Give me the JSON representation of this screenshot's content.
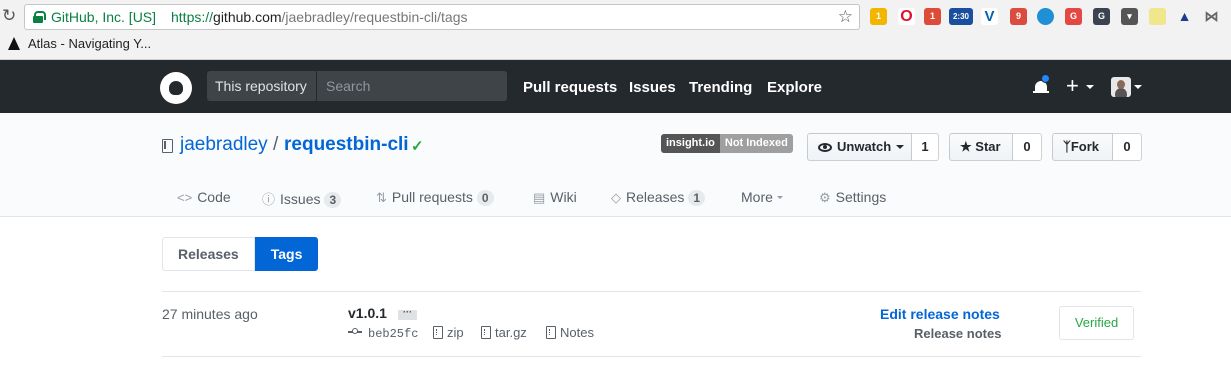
{
  "browser": {
    "secure_label": "GitHub, Inc. [US]",
    "url_scheme": "https://",
    "url_host": "github.com",
    "url_path": "/jaebradley/requestbin-cli/tags",
    "bookmark_label": "Atlas - Navigating Y...",
    "extension_badges": {
      "mail": "1",
      "time": "2:30",
      "todo": "9",
      "first": "1"
    }
  },
  "header": {
    "search_scope": "This repository",
    "search_placeholder": "Search",
    "nav": [
      "Pull requests",
      "Issues",
      "Trending",
      "Explore"
    ],
    "plus": "+"
  },
  "repo": {
    "owner": "jaebradley",
    "separator": "/",
    "name": "requestbin-cli",
    "verified_check": "✓",
    "insight_label": "insight.io",
    "insight_status": "Not Indexed",
    "unwatch_label": "Unwatch",
    "watch_count": "1",
    "star_label": "Star",
    "star_count": "0",
    "fork_label": "Fork",
    "fork_count": "0"
  },
  "tabs": {
    "code": "Code",
    "issues": "Issues",
    "issues_count": "3",
    "pulls": "Pull requests",
    "pulls_count": "0",
    "wiki": "Wiki",
    "releases": "Releases",
    "releases_count": "1",
    "more": "More",
    "settings": "Settings"
  },
  "subnav": {
    "releases": "Releases",
    "tags": "Tags"
  },
  "tag": {
    "time_ago": "27 minutes ago",
    "name": "v1.0.1",
    "ellipsis": "···",
    "commit": "beb25fc",
    "zip": "zip",
    "targz": "tar.gz",
    "notes": "Notes",
    "edit_release_notes": "Edit release notes",
    "release_notes": "Release notes",
    "verified": "Verified"
  }
}
